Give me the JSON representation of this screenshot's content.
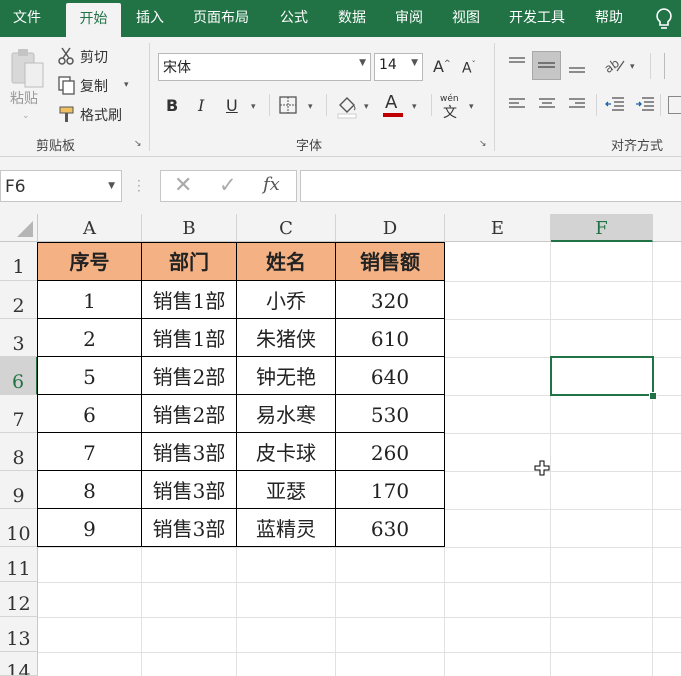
{
  "tabs": [
    {
      "label": "文件",
      "active": false
    },
    {
      "label": "开始",
      "active": true
    },
    {
      "label": "插入",
      "active": false
    },
    {
      "label": "页面布局",
      "active": false
    },
    {
      "label": "公式",
      "active": false
    },
    {
      "label": "数据",
      "active": false
    },
    {
      "label": "审阅",
      "active": false
    },
    {
      "label": "视图",
      "active": false
    },
    {
      "label": "开发工具",
      "active": false
    },
    {
      "label": "帮助",
      "active": false
    }
  ],
  "clipboard": {
    "paste_label": "粘贴",
    "cut_label": "剪切",
    "copy_label": "复制",
    "format_painter_label": "格式刷",
    "group_label": "剪贴板"
  },
  "font": {
    "name": "宋体",
    "size": "14",
    "group_label": "字体",
    "bold": "B",
    "italic": "I",
    "underline": "U",
    "grow": "A",
    "shrink": "A",
    "color_letter": "A",
    "phonetic_top": "wén",
    "phonetic_bottom": "文"
  },
  "alignment": {
    "group_label": "对齐方式"
  },
  "formula_bar": {
    "name_box": "F6",
    "fx": "fx",
    "formula": ""
  },
  "grid": {
    "columns": [
      "A",
      "B",
      "C",
      "D",
      "E",
      "F"
    ],
    "selected_column": "F",
    "rows": [
      "1",
      "2",
      "3",
      "6",
      "7",
      "8",
      "9",
      "10",
      "11",
      "12",
      "13",
      "14"
    ],
    "selected_row": "6",
    "selected_cell": "F6"
  },
  "table": {
    "headers": [
      "序号",
      "部门",
      "姓名",
      "销售额"
    ],
    "rows": [
      [
        "1",
        "销售1部",
        "小乔",
        "320"
      ],
      [
        "2",
        "销售1部",
        "朱猪侠",
        "610"
      ],
      [
        "5",
        "销售2部",
        "钟无艳",
        "640"
      ],
      [
        "6",
        "销售2部",
        "易水寒",
        "530"
      ],
      [
        "7",
        "销售3部",
        "皮卡球",
        "260"
      ],
      [
        "8",
        "销售3部",
        "亚瑟",
        "170"
      ],
      [
        "9",
        "销售3部",
        "蓝精灵",
        "630"
      ]
    ]
  },
  "colors": {
    "accent": "#217346",
    "header_fill": "#f4b183",
    "font_color_bar": "#c00000"
  }
}
